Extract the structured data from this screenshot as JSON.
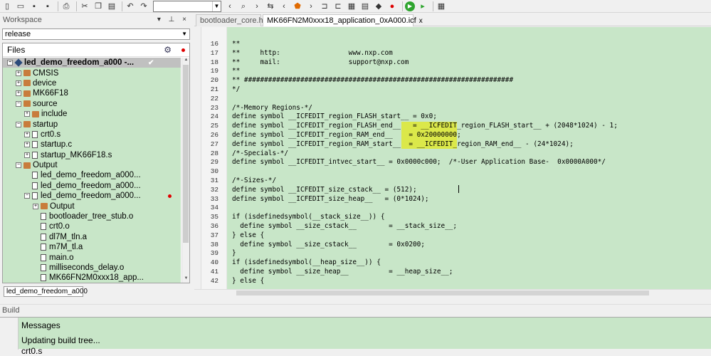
{
  "toolbar": {
    "icons": [
      "new-file",
      "open",
      "save",
      "save-all",
      "print",
      "cut",
      "copy",
      "paste",
      "undo",
      "redo"
    ],
    "search_value": "",
    "colors": {
      "run": "#2fa52f"
    }
  },
  "workspace": {
    "title": "Workspace",
    "config": "release",
    "files_label": "Files",
    "tab_label": "led_demo_freedom_a000"
  },
  "tree": [
    {
      "label": "led_demo_freedom_a000 -...",
      "level": 0,
      "type": "project",
      "expander": "−",
      "selected": true,
      "check": true
    },
    {
      "label": "CMSIS",
      "level": 1,
      "type": "folder",
      "expander": "+"
    },
    {
      "label": "device",
      "level": 1,
      "type": "folder",
      "expander": "+"
    },
    {
      "label": "MK66F18",
      "level": 1,
      "type": "folder",
      "expander": "+"
    },
    {
      "label": "source",
      "level": 1,
      "type": "folder",
      "expander": "−"
    },
    {
      "label": "include",
      "level": 2,
      "type": "folder",
      "expander": "+"
    },
    {
      "label": "startup",
      "level": 1,
      "type": "folder",
      "expander": "−"
    },
    {
      "label": "crt0.s",
      "level": 2,
      "type": "file",
      "expander": "+"
    },
    {
      "label": "startup.c",
      "level": 2,
      "type": "file",
      "expander": "+"
    },
    {
      "label": "startup_MK66F18.s",
      "level": 2,
      "type": "file",
      "expander": "+"
    },
    {
      "label": "Output",
      "level": 1,
      "type": "folder",
      "expander": "−"
    },
    {
      "label": "led_demo_freedom_a000...",
      "level": 2,
      "type": "file",
      "expander": ""
    },
    {
      "label": "led_demo_freedom_a000...",
      "level": 2,
      "type": "file",
      "expander": ""
    },
    {
      "label": "led_demo_freedom_a000...",
      "level": 2,
      "type": "file",
      "expander": "−",
      "dot": true
    },
    {
      "label": "Output",
      "level": 3,
      "type": "folder",
      "expander": "+"
    },
    {
      "label": "bootloader_tree_stub.o",
      "level": 3,
      "type": "file",
      "expander": ""
    },
    {
      "label": "crt0.o",
      "level": 3,
      "type": "file",
      "expander": ""
    },
    {
      "label": "dl7M_tln.a",
      "level": 3,
      "type": "file",
      "expander": ""
    },
    {
      "label": "m7M_tl.a",
      "level": 3,
      "type": "file",
      "expander": ""
    },
    {
      "label": "main.o",
      "level": 3,
      "type": "file",
      "expander": ""
    },
    {
      "label": "milliseconds_delay.o",
      "level": 3,
      "type": "file",
      "expander": ""
    },
    {
      "label": "MK66FN2M0xxx18_app...",
      "level": 3,
      "type": "file",
      "expander": ""
    }
  ],
  "editor": {
    "tabs": [
      {
        "label": "bootloader_core.h",
        "active": false
      },
      {
        "label": "MK66FN2M0xxx18_application_0xA000.icf",
        "active": true,
        "close": "x"
      }
    ],
    "lines": [
      {
        "n": "16",
        "text": "**"
      },
      {
        "n": "17",
        "text": "**     http:                 www.nxp.com"
      },
      {
        "n": "18",
        "text": "**     mail:                 support@nxp.com"
      },
      {
        "n": "19",
        "text": "**"
      },
      {
        "n": "20",
        "text": "** ###################################################################"
      },
      {
        "n": "21",
        "text": "*/"
      },
      {
        "n": "22",
        "text": ""
      },
      {
        "n": "23",
        "text": "/*-Memory Regions-*/"
      },
      {
        "n": "24",
        "text": "define symbol __ICFEDIT_region_FLASH_start__ = 0x0;"
      },
      {
        "n": "25",
        "text": "define symbol __ICFEDIT_region_FLASH_end__   = __ICFEDIT_region_FLASH_start__ + (2048*1024) - 1;"
      },
      {
        "n": "26",
        "text": "define symbol __ICFEDIT_region_RAM_end__    = 0x20000000;"
      },
      {
        "n": "27",
        "text": "define symbol __ICFEDIT_region_RAM_start__  = __ICFEDIT_region_RAM_end__ - (24*1024);"
      },
      {
        "n": "28",
        "text": "/*-Specials-*/"
      },
      {
        "n": "29",
        "text": "define symbol __ICFEDIT_intvec_start__ = 0x0000c000;  /*-User Application Base-  0x0000A000*/"
      },
      {
        "n": "30",
        "text": ""
      },
      {
        "n": "31",
        "text": "/*-Sizes-*/"
      },
      {
        "n": "32",
        "text": "define symbol __ICFEDIT_size_cstack__ = (512);"
      },
      {
        "n": "33",
        "text": "define symbol __ICFEDIT_size_heap__   = (0*1024);"
      },
      {
        "n": "34",
        "text": ""
      },
      {
        "n": "35",
        "text": "if (isdefinedsymbol(__stack_size__)) {"
      },
      {
        "n": "36",
        "text": "  define symbol __size_cstack__        = __stack_size__;"
      },
      {
        "n": "37",
        "text": "} else {"
      },
      {
        "n": "38",
        "text": "  define symbol __size_cstack__        = 0x0200;"
      },
      {
        "n": "39",
        "text": "}"
      },
      {
        "n": "40",
        "text": "if (isdefinedsymbol(__heap_size__)) {"
      },
      {
        "n": "41",
        "text": "  define symbol __size_heap__          = __heap_size__;"
      },
      {
        "n": "42",
        "text": "} else {"
      }
    ],
    "highlight_color": "#dbe84a"
  },
  "build": {
    "title": "Build",
    "messages_header": "Messages",
    "rows": [
      "Updating build tree...",
      "crt0.s"
    ]
  }
}
